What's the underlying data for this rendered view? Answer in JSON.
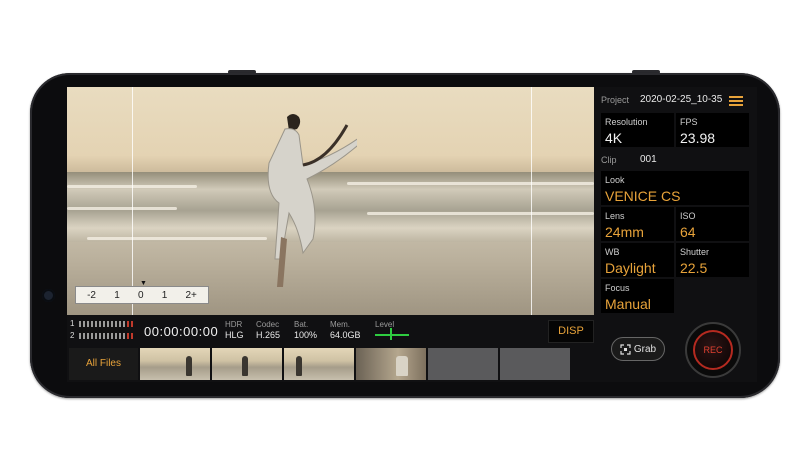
{
  "viewfinder": {
    "level_scale": [
      "-2",
      "1",
      "0",
      "1",
      "2+"
    ]
  },
  "infobar": {
    "channels": [
      "1",
      "2"
    ],
    "timecode": "00:00:00:00",
    "hdr": {
      "label": "HDR",
      "value": "HLG"
    },
    "codec": {
      "label": "Codec",
      "value": "H.265"
    },
    "battery": {
      "label": "Bat.",
      "value": "100%"
    },
    "memory": {
      "label": "Mem.",
      "value": "64.0GB"
    },
    "level": {
      "label": "Level"
    },
    "disp_label": "DISP"
  },
  "thumbnails": {
    "all_files_label": "All Files"
  },
  "panel": {
    "project_label": "Project",
    "project_value": "2020-02-25_10-35",
    "clip_label": "Clip",
    "clip_value": "001",
    "resolution": {
      "label": "Resolution",
      "value": "4K"
    },
    "fps": {
      "label": "FPS",
      "value": "23.98"
    },
    "look": {
      "label": "Look",
      "value": "VENICE CS"
    },
    "lens": {
      "label": "Lens",
      "value": "24mm"
    },
    "iso": {
      "label": "ISO",
      "value": "64"
    },
    "wb": {
      "label": "WB",
      "value": "Daylight"
    },
    "shutter": {
      "label": "Shutter",
      "value": "22.5"
    },
    "focus": {
      "label": "Focus",
      "value": "Manual"
    },
    "grab_label": "Grab",
    "rec_label": "REC"
  },
  "colors": {
    "accent": "#e8a33a",
    "rec_red": "#b52a20",
    "level_green": "#2ecc40"
  },
  "icons": [
    "menu-icon",
    "grab-icon",
    "rec-button-icon"
  ]
}
